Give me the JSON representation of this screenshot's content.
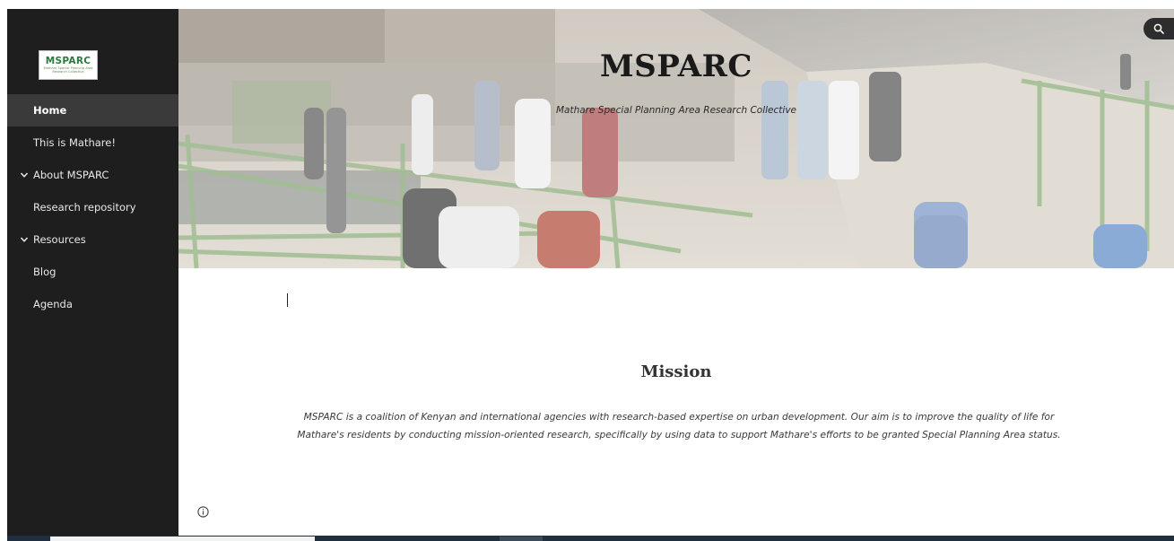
{
  "site": {
    "logo_text": "MSPARC",
    "logo_subtext": "Mathare Special Planning Area Research Collective"
  },
  "nav": {
    "items": [
      {
        "label": "Home",
        "active": true,
        "expandable": false
      },
      {
        "label": "This is Mathare!",
        "active": false,
        "expandable": false
      },
      {
        "label": "About MSPARC",
        "active": false,
        "expandable": true
      },
      {
        "label": "Research repository",
        "active": false,
        "expandable": false
      },
      {
        "label": "Resources",
        "active": false,
        "expandable": true
      },
      {
        "label": "Blog",
        "active": false,
        "expandable": false
      },
      {
        "label": "Agenda",
        "active": false,
        "expandable": false
      }
    ]
  },
  "hero": {
    "title": "MSPARC",
    "subtitle": "Mathare Special Planning Area Research Collective"
  },
  "icons": {
    "search": "search-icon",
    "info": "info-icon",
    "chevron": "chevron-down-icon"
  },
  "mission": {
    "title": "Mission",
    "body": "MSPARC is a coalition of Kenyan and international agencies with research-based expertise on urban development. Our aim is to improve the quality of life for Mathare's residents by conducting mission-oriented research, specifically by using data to support Mathare's efforts to be granted Special Planning Area status."
  },
  "colors": {
    "sidebar_bg": "#1e1e1e",
    "sidebar_active": "#3a3a3a",
    "logo_green": "#2a7a3a",
    "logo_red": "#d64a2a"
  }
}
